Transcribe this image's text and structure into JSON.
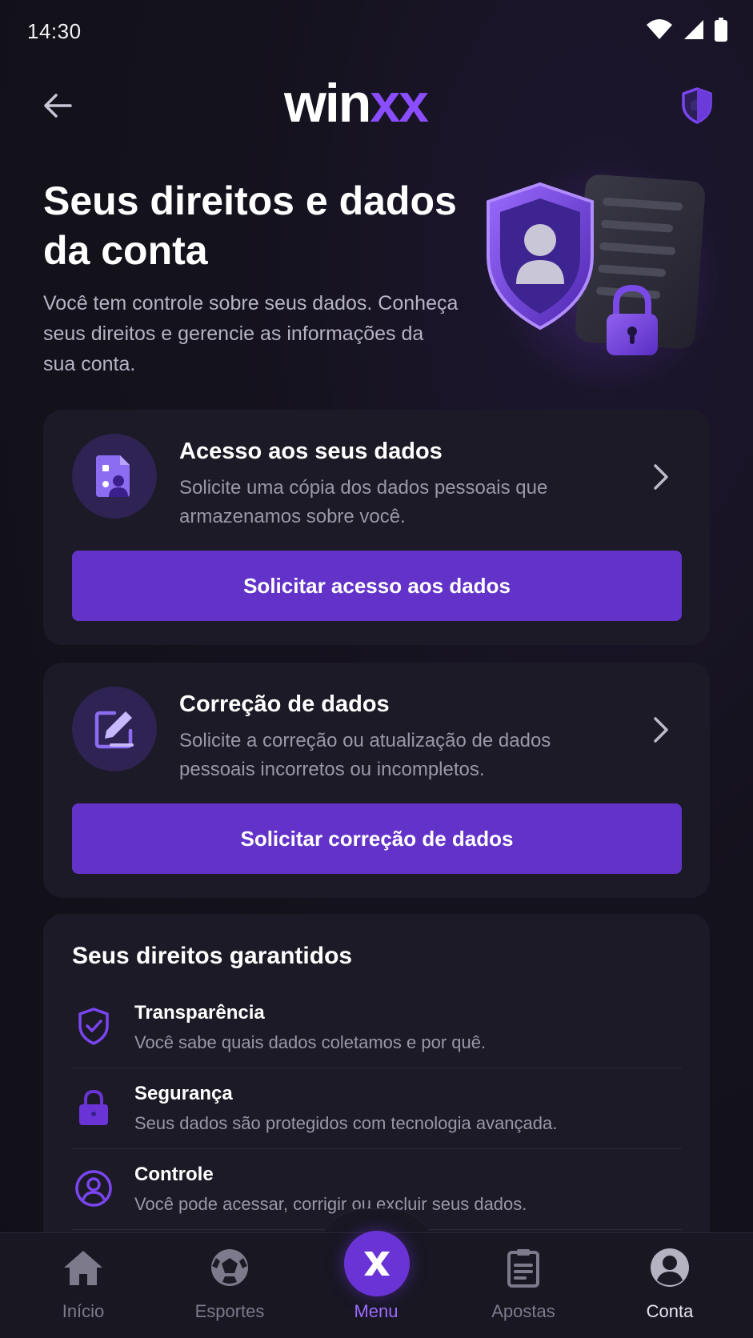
{
  "status_bar": {
    "time": "14:30"
  },
  "top_bar": {
    "logo_part1": "win",
    "logo_part2": "xx"
  },
  "hero": {
    "title": "Seus direitos e dados da conta",
    "subtitle": "Você tem controle sobre seus dados. Conheça seus direitos e gerencie as informações da sua conta."
  },
  "cards": [
    {
      "title": "Acesso aos seus dados",
      "description": "Solicite uma cópia dos dados pessoais que armazenamos sobre você.",
      "button_label": "Solicitar acesso aos dados",
      "icon": "document-user-icon"
    },
    {
      "title": "Correção de dados",
      "description": "Solicite a correção ou atualização de dados pessoais incorretos ou incompletos.",
      "button_label": "Solicitar correção de dados",
      "icon": "edit-icon"
    }
  ],
  "rights": {
    "title": "Seus direitos garantidos",
    "items": [
      {
        "name": "Transparência",
        "description": "Você sabe quais dados coletamos e por quê.",
        "icon": "shield-check-icon"
      },
      {
        "name": "Segurança",
        "description": "Seus dados são protegidos com tecnologia avançada.",
        "icon": "lock-icon"
      },
      {
        "name": "Controle",
        "description": "Você pode acessar, corrigir ou excluir seus dados.",
        "icon": "user-circle-icon"
      }
    ]
  },
  "bottom_nav": {
    "items": [
      {
        "label": "Início",
        "icon": "home-icon"
      },
      {
        "label": "Esportes",
        "icon": "soccer-ball-icon"
      },
      {
        "label": "Menu",
        "icon": "x-logo-icon"
      },
      {
        "label": "Apostas",
        "icon": "clipboard-icon"
      },
      {
        "label": "Conta",
        "icon": "account-icon"
      }
    ],
    "active": "Menu"
  },
  "colors": {
    "accent": "#6333c9",
    "accent_light": "#8a4dff",
    "background": "#12111a",
    "card": "#1c1a26"
  }
}
